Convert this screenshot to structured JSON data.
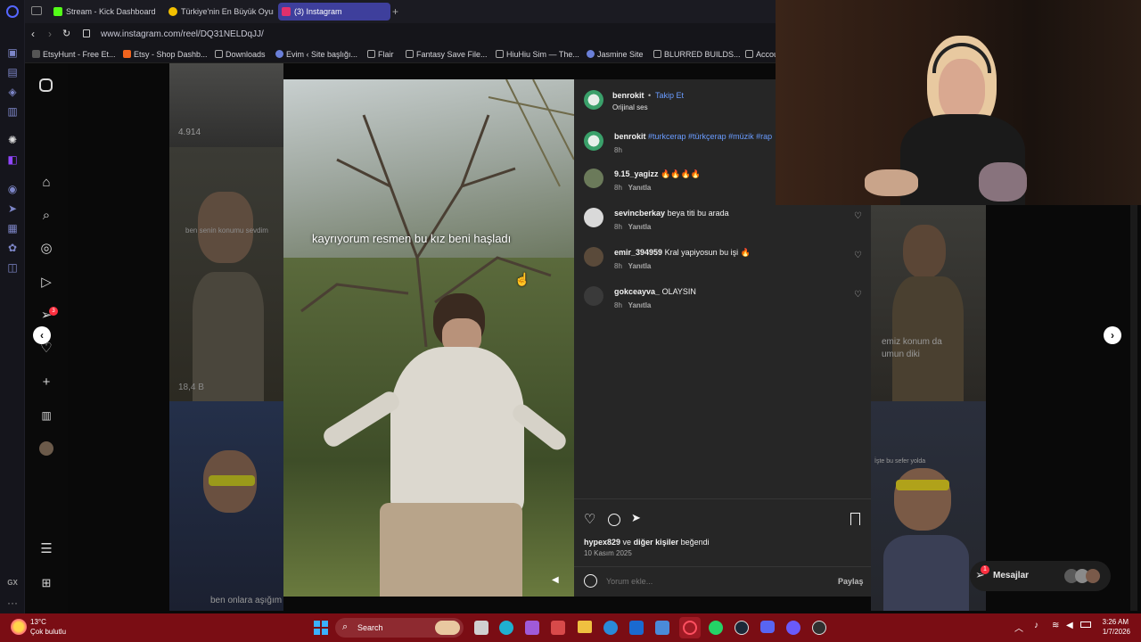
{
  "browser": {
    "tabs": [
      {
        "label": "Stream - Kick Dashboard",
        "color": "#53fc18"
      },
      {
        "label": "Türkiye'nin En Büyük Oyun",
        "color": "#f3c000"
      },
      {
        "label": "(3) Instagram",
        "color": "#e1306c"
      }
    ],
    "add_tab": "+",
    "url": "www.instagram.com/reel/DQ31NELDqJJ/",
    "bookmarks": [
      {
        "label": "EtsyHunt - Free Et..."
      },
      {
        "label": "Etsy - Shop Dashb..."
      },
      {
        "label": "Downloads"
      },
      {
        "label": "Evim ‹ Site başlığı..."
      },
      {
        "label": "Flair"
      },
      {
        "label": "Fantasy Save File..."
      },
      {
        "label": "HiuHiu Sim — The..."
      },
      {
        "label": "Jasmine Site"
      },
      {
        "label": "BLURRED BUILDS..."
      },
      {
        "label": "Accou"
      }
    ]
  },
  "feed": {
    "views_1": "4.914",
    "views_2": "18,4 B",
    "thumb_caption_1": "ben senin konumu sevdim",
    "thumb_caption_2": "ben onlara aşığım",
    "thumb_caption_3": "emiz konum da",
    "thumb_caption_4": "umun diki",
    "thumb_caption_5": "İşte bu sefer yolda"
  },
  "video": {
    "caption": "kayrıyorum resmen bu kız beni haşladı"
  },
  "post": {
    "author": "benrokit",
    "separator": "•",
    "follow": "Takip Et",
    "audio": "Orijinal ses",
    "caption_user": "benrokit",
    "caption_tags": "#turkcerap #türkçerap #müzik #rap",
    "caption_time": "8h",
    "comments": [
      {
        "user": "9.15_yagizz",
        "text": "🔥🔥🔥🔥",
        "time": "8h",
        "reply": "Yanıtla",
        "avatar": "#6b7a5a"
      },
      {
        "user": "sevincberkay",
        "text": "beya titi bu arada",
        "time": "8h",
        "reply": "Yanıtla",
        "avatar": "#d9d9d9"
      },
      {
        "user": "emir_394959",
        "text": "Kral yapiyosun bu işi 🔥",
        "time": "8h",
        "reply": "Yanıtla",
        "avatar": "#5a4a3a"
      },
      {
        "user": "gokceayva_",
        "text": "OLAYSIN",
        "time": "8h",
        "reply": "Yanıtla",
        "avatar": "#3a3a3a"
      }
    ],
    "liked_by": "hypex829",
    "liked_conj": "ve",
    "liked_rest": "diğer kişiler",
    "liked_suffix": "beğendi",
    "date": "10 Kasım 2025",
    "comment_placeholder": "Yorum ekle...",
    "share": "Paylaş"
  },
  "messages": {
    "label": "Mesajlar",
    "badge": "1"
  },
  "nav_badge": "3",
  "taskbar": {
    "temp": "13°C",
    "weather": "Çok bulutlu",
    "search": "Search",
    "time": "3:26 AM",
    "date": "1/7/2026"
  }
}
